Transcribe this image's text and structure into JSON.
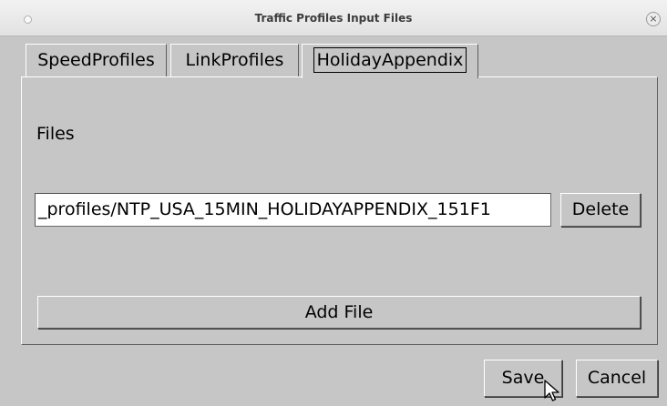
{
  "window": {
    "title": "Traffic Profiles Input Files",
    "close_glyph": "×"
  },
  "tabs": [
    {
      "label": "SpeedProfiles",
      "active": false
    },
    {
      "label": "LinkProfiles",
      "active": false
    },
    {
      "label": "HolidayAppendix",
      "active": true
    }
  ],
  "panel": {
    "files_label": "Files",
    "file_value": "_profiles/NTP_USA_15MIN_HOLIDAYAPPENDIX_151F1",
    "delete_label": "Delete",
    "add_file_label": "Add File"
  },
  "footer": {
    "save_label": "Save",
    "cancel_label": "Cancel"
  },
  "icons": {
    "close": "close-icon",
    "cursor": "mouse-pointer-icon"
  }
}
